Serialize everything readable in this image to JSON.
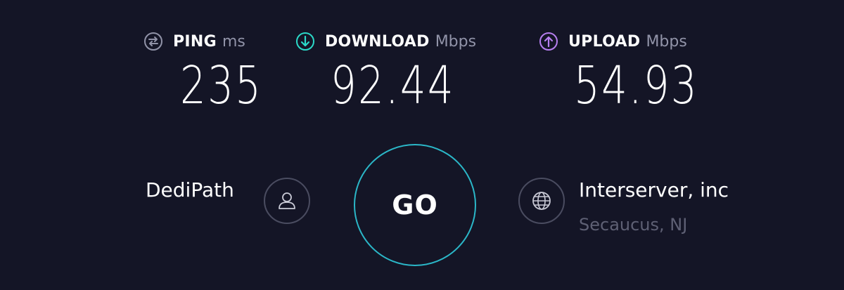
{
  "metrics": {
    "ping": {
      "label": "PING",
      "unit": "ms",
      "value": "235",
      "icon": "ping-icon",
      "color": "#9193a8"
    },
    "download": {
      "label": "DOWNLOAD",
      "unit": "Mbps",
      "value": "92.44",
      "icon": "download-arrow-icon",
      "color": "#2bd9c8"
    },
    "upload": {
      "label": "UPLOAD",
      "unit": "Mbps",
      "value": "54.93",
      "icon": "upload-arrow-icon",
      "color": "#b77ff0"
    }
  },
  "isp": {
    "name": "DediPath",
    "icon": "user-icon"
  },
  "go_button": {
    "label": "GO",
    "ring_color": "#2bb7c8"
  },
  "server": {
    "name": "Interserver, inc",
    "location": "Secaucus, NJ",
    "icon": "globe-icon"
  },
  "colors": {
    "background": "#141526",
    "muted_text": "#9193a8",
    "location_text": "#5e6074"
  }
}
